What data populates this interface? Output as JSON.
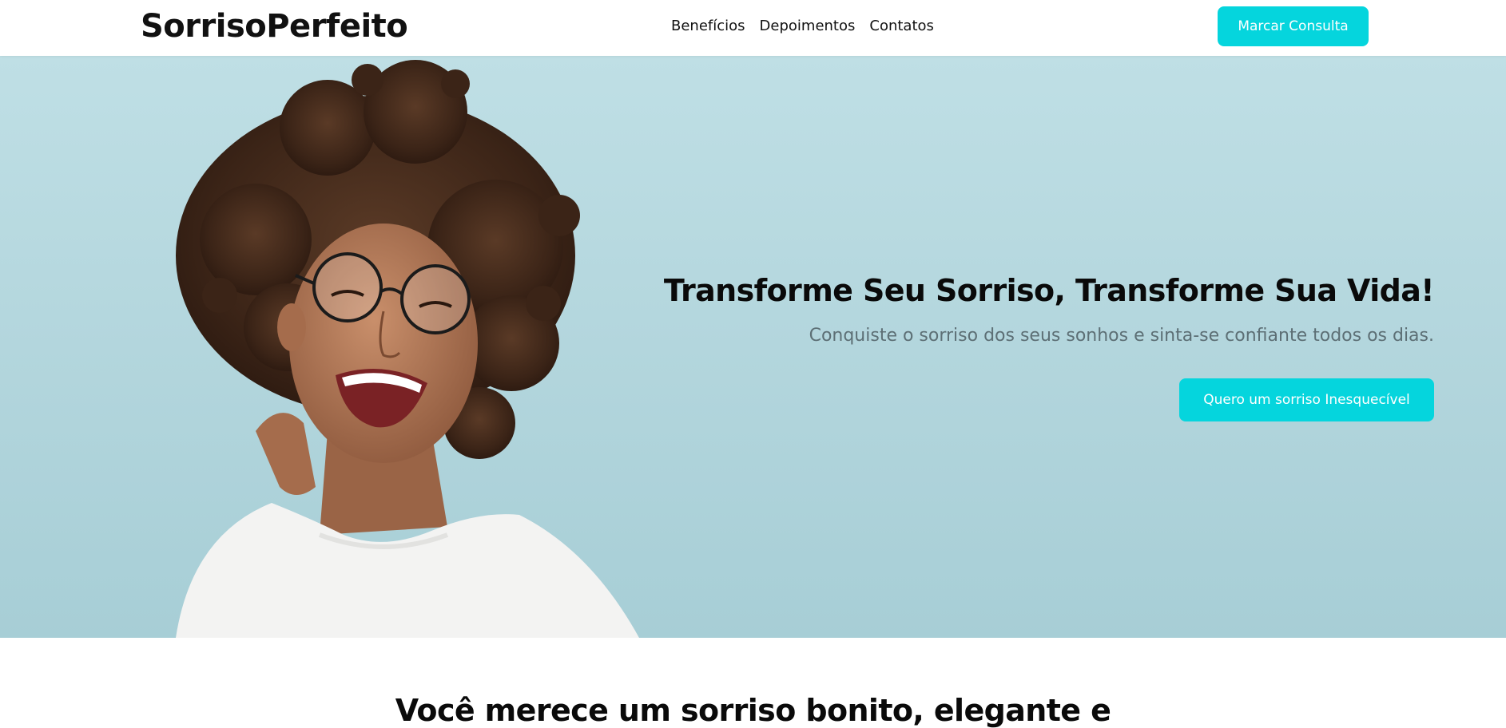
{
  "header": {
    "logo": "SorrisoPerfeito",
    "nav": [
      "Benefícios",
      "Depoimentos",
      "Contatos"
    ],
    "cta_label": "Marcar Consulta"
  },
  "hero": {
    "title": "Transforme Seu Sorriso, Transforme Sua Vida!",
    "subtitle": "Conquiste o sorriso dos seus sonhos e sinta-se confiante todos os dias.",
    "cta_label": "Quero um sorriso Inesquecível"
  },
  "section": {
    "title": "Você merece um sorriso bonito, elegante e"
  },
  "colors": {
    "accent": "#05d5dd",
    "hero_background": "#b3d6dd",
    "subtitle_text": "#5d6f75"
  }
}
